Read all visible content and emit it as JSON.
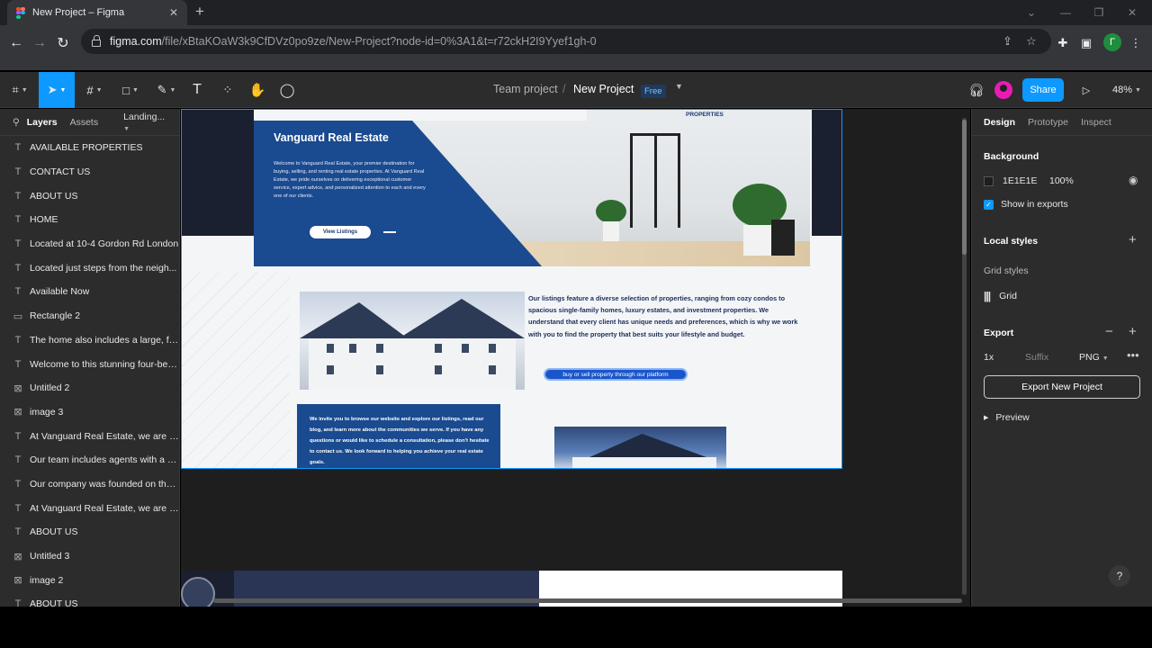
{
  "browser": {
    "tab_title": "New Project – Figma",
    "url_host": "figma.com",
    "url_path": "/file/xBtaKOaW3k9CfDVz0po9ze/New-Project?node-id=0%3A1&t=r72ckH2I9Yyef1gh-0",
    "profile_initial": "Г"
  },
  "toolbar": {
    "team": "Team project",
    "separator": "/",
    "project": "New Project",
    "plan_badge": "Free",
    "share_label": "Share",
    "zoom": "48%"
  },
  "layers_panel": {
    "tabs": [
      "Layers",
      "Assets"
    ],
    "page": "Landing...",
    "items": [
      {
        "icon": "text-icon",
        "name": "AVAILABLE PROPERTIES"
      },
      {
        "icon": "text-icon",
        "name": "CONTACT US"
      },
      {
        "icon": "text-icon",
        "name": "ABOUT US"
      },
      {
        "icon": "text-icon",
        "name": "HOME"
      },
      {
        "icon": "text-icon",
        "name": "Located at 10-4 Gordon Rd London"
      },
      {
        "icon": "text-icon",
        "name": "Located just steps from the neigh..."
      },
      {
        "icon": "text-icon",
        "name": "Available Now"
      },
      {
        "icon": "rectangle-icon",
        "name": "Rectangle 2"
      },
      {
        "icon": "text-icon",
        "name": "The home also includes a large, ful..."
      },
      {
        "icon": "text-icon",
        "name": "Welcome to this stunning four-bed..."
      },
      {
        "icon": "image-icon",
        "name": "Untitled 2"
      },
      {
        "icon": "image-icon",
        "name": "image 3"
      },
      {
        "icon": "text-icon",
        "name": "At Vanguard Real Estate, we are p..."
      },
      {
        "icon": "text-icon",
        "name": "Our team includes agents with a ra..."
      },
      {
        "icon": "text-icon",
        "name": "Our company was founded on the ..."
      },
      {
        "icon": "text-icon",
        "name": "At Vanguard Real Estate, we are c..."
      },
      {
        "icon": "text-icon",
        "name": "ABOUT US"
      },
      {
        "icon": "image-icon",
        "name": "Untitled 3"
      },
      {
        "icon": "image-icon",
        "name": "image 2"
      },
      {
        "icon": "text-icon",
        "name": "ABOUT US"
      }
    ]
  },
  "canvas": {
    "nav_properties": "PROPERTIES",
    "hero_title": "Vanguard Real Estate",
    "hero_text": "Welcome to Vanguard Real Estate, your premier destination for buying, selling, and renting real estate properties. At Vanguard Real Estate, we pride ourselves on delivering exceptional customer service, expert advice, and personalized attention to each and every one of our clients.",
    "view_listings": "View Listings",
    "listings_text": "Our listings feature a diverse selection of properties, ranging from cozy condos to spacious single-family homes, luxury estates, and investment properties. We understand that every client has unique needs and preferences, which is why we work with you to find the property that best suits your lifestyle and budget.",
    "cta_pill": "buy or sell property through our platform",
    "invite_text": "We invite you to browse our website and explore our listings, read our blog, and learn more about the communities we serve. If you have any questions or would like to schedule a consultation, please don't hesitate to contact us. We look forward to helping you achieve your real estate goals."
  },
  "design_panel": {
    "tabs": [
      "Design",
      "Prototype",
      "Inspect"
    ],
    "background_title": "Background",
    "bg_hex": "1E1E1E",
    "bg_opacity": "100%",
    "show_in_exports": "Show in exports",
    "local_styles": "Local styles",
    "grid_styles": "Grid styles",
    "grid_label": "Grid",
    "export_title": "Export",
    "export_scale": "1x",
    "export_suffix": "Suffix",
    "export_format": "PNG",
    "export_button": "Export New Project",
    "preview": "Preview"
  },
  "help": "?",
  "colors": {
    "figma_blue": "#0d99ff",
    "panel_bg": "#2c2c2c",
    "canvas_bg": "#1e1e1e",
    "site_blue": "#1a4a8f"
  }
}
